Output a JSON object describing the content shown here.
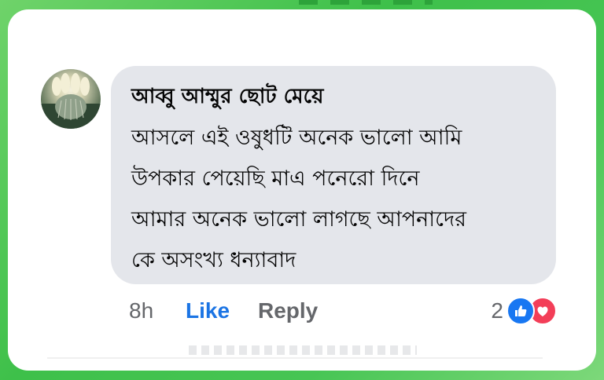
{
  "comment": {
    "author": "আব্বু আম্মুর ছোট মেয়ে",
    "text_lines": [
      "আসলে এই ওষুধটি অনেক ভালো আমি",
      "উপকার পেয়েছি মাএ পনেরো দিনে",
      "আমার অনেক ভালো লাগছে আপনাদের",
      "কে অসংখ্য ধন্যাবাদ"
    ],
    "timestamp": "8h",
    "like_label": "Like",
    "reply_label": "Reply",
    "reaction_count": "2",
    "reactions": [
      "like-icon",
      "love-icon"
    ]
  },
  "colors": {
    "bubble": "#e4e6eb",
    "like_blue": "#1b74e4",
    "love_red": "#f33e58",
    "muted": "#65676b",
    "frame_green": "#3ec04a"
  }
}
